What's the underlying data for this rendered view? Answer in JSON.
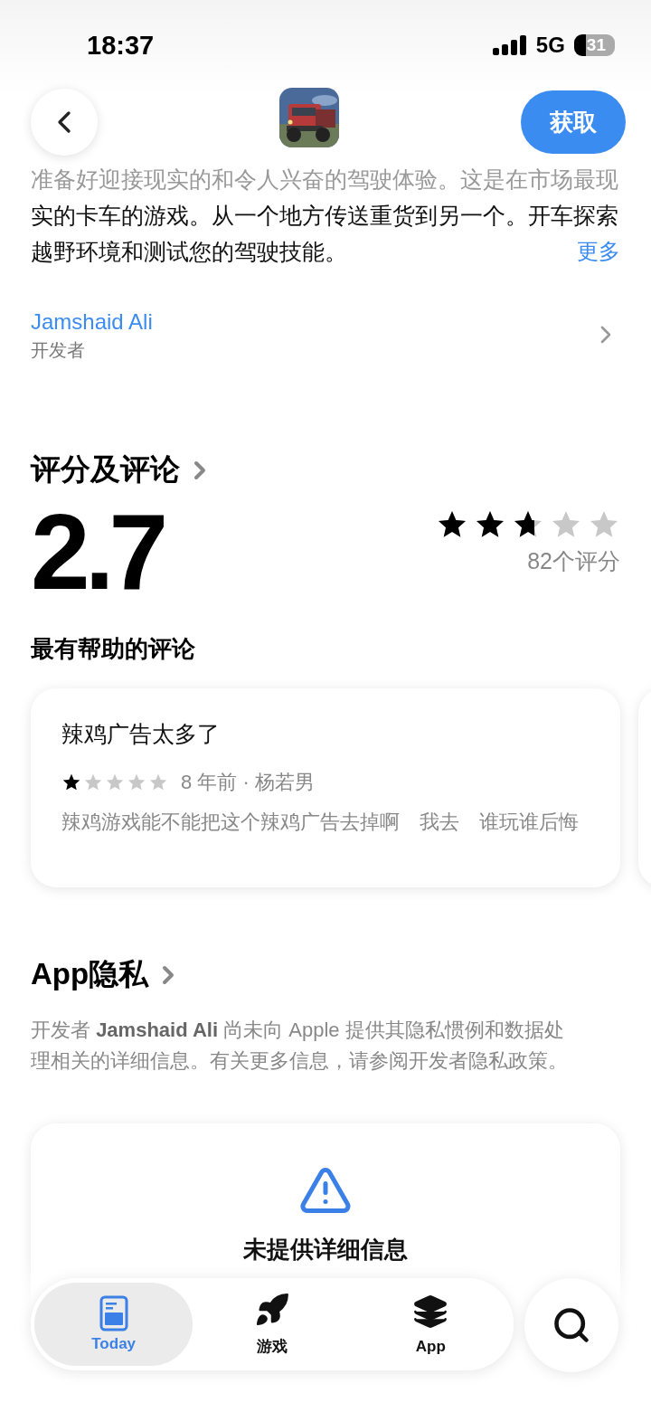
{
  "status_bar": {
    "time": "18:37",
    "network": "5G",
    "battery": "31"
  },
  "header": {
    "get_button": "获取"
  },
  "description": {
    "faded_line": "准备好迎接现实的和令人兴奋的驾驶体验。这是在市场最现",
    "lines": [
      "实的卡车的游戏。从一个地方传送重货到另一个。开车探索",
      "越野环境和测试您的驾驶技能。"
    ],
    "more": "更多"
  },
  "developer": {
    "name": "Jamshaid Ali",
    "label": "开发者"
  },
  "ratings": {
    "title": "评分及评论",
    "score": "2.7",
    "stars": 2.7,
    "count": "82个评分",
    "helpful_title": "最有帮助的评论",
    "reviews": [
      {
        "title": "辣鸡广告太多了",
        "stars": 1,
        "meta": "8 年前 · 杨若男",
        "body": "辣鸡游戏能不能把这个辣鸡广告去掉啊　我去　谁玩谁后悔"
      }
    ]
  },
  "privacy": {
    "title": "App隐私",
    "text": "开发者 **Jamshaid Ali** 尚未向 Apple 提供其隐私惯例和数据处理相关的详细信息。有关更多信息，请参阅开发者隐私政策。",
    "card_title": "未提供详细信息"
  },
  "tabs": [
    {
      "label": "Today",
      "kind": "today",
      "selected": true
    },
    {
      "label": "游戏",
      "kind": "games",
      "selected": false
    },
    {
      "label": "App",
      "kind": "apps",
      "selected": false
    }
  ]
}
